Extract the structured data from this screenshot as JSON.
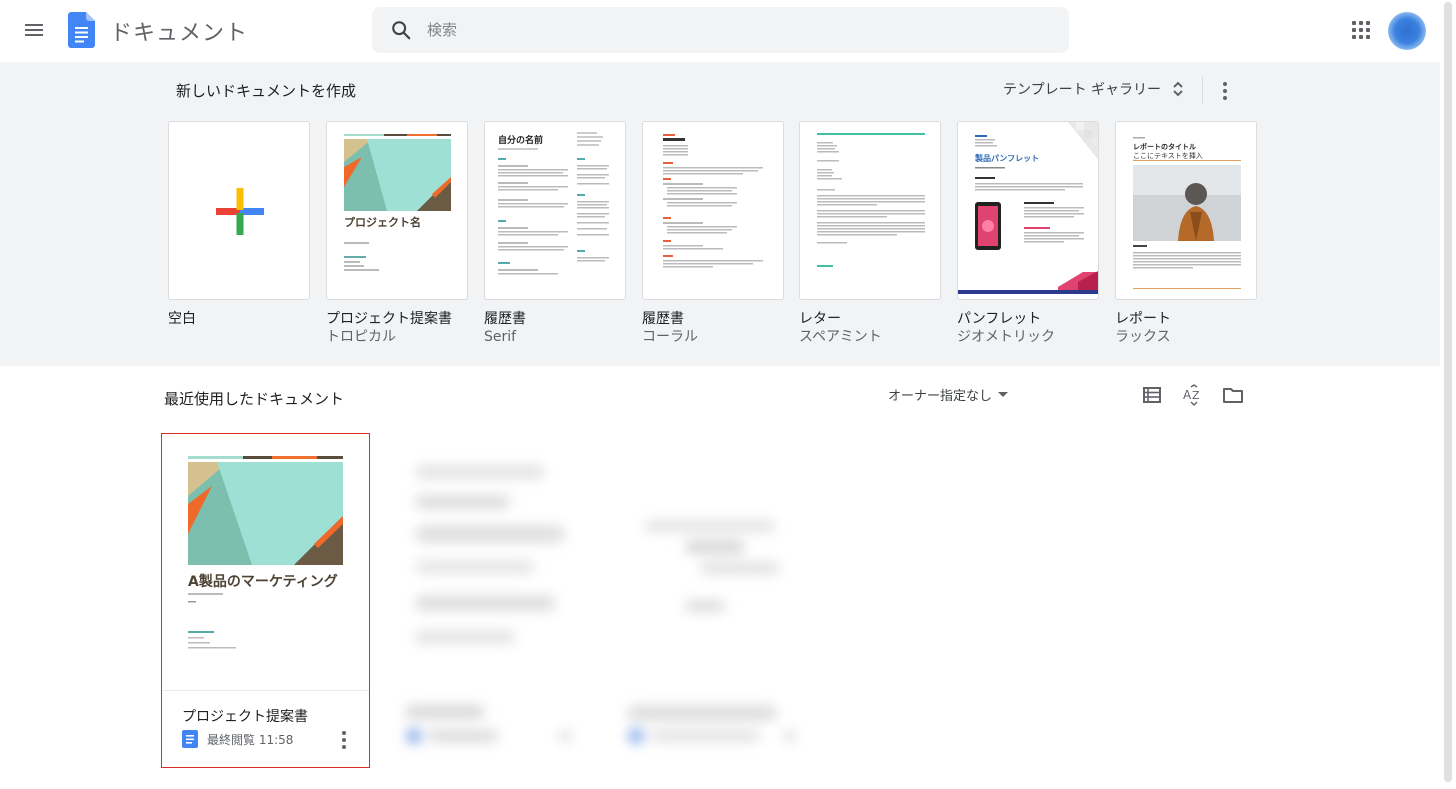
{
  "header": {
    "app_title": "ドキュメント",
    "search_placeholder": "検索",
    "icons": [
      "menu-icon",
      "docs-logo-icon",
      "search-icon",
      "apps-grid-icon",
      "avatar"
    ]
  },
  "templates": {
    "heading": "新しいドキュメントを作成",
    "gallery_label": "テンプレート ギャラリー",
    "items": [
      {
        "name": "空白",
        "sub": ""
      },
      {
        "name": "プロジェクト提案書",
        "sub": "トロピカル",
        "thumb_title": "プロジェクト名"
      },
      {
        "name": "履歴書",
        "sub": "Serif",
        "thumb_title": "自分の名前"
      },
      {
        "name": "履歴書",
        "sub": "コーラル"
      },
      {
        "name": "レター",
        "sub": "スペアミント"
      },
      {
        "name": "パンフレット",
        "sub": "ジオメトリック",
        "thumb_title": "製品パンフレット"
      },
      {
        "name": "レポート",
        "sub": "ラックス",
        "thumb_title": "レポートのタイトル",
        "thumb_subtitle": "ここにテキストを挿入"
      }
    ]
  },
  "recent": {
    "heading": "最近使用したドキュメント",
    "owner_filter": "オーナー指定なし",
    "documents": [
      {
        "title": "プロジェクト提案書",
        "thumb_title": "A製品のマーケティング",
        "meta": "最終閲覧 11:58"
      }
    ]
  },
  "colors": {
    "docs_blue": "#4285f4",
    "background_gray": "#f1f3f4",
    "selection_red": "#d93025"
  }
}
